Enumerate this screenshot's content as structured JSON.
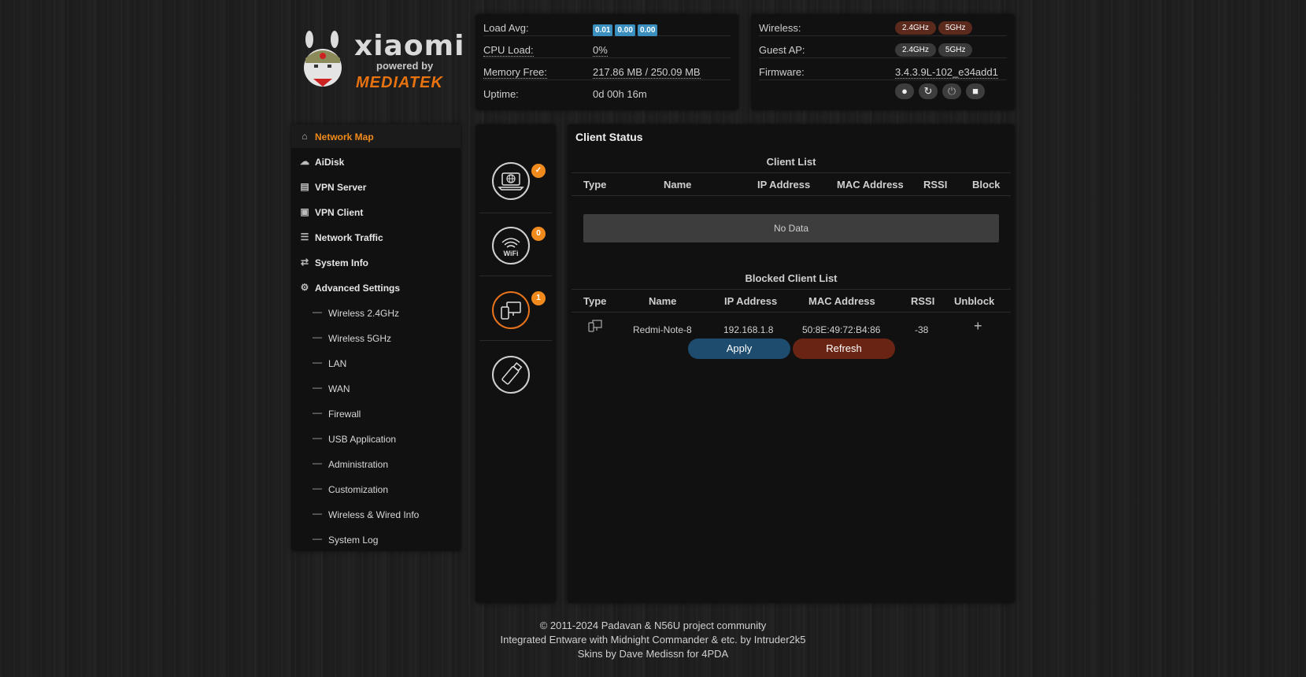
{
  "logo": {
    "brand": "xiaomi",
    "powered": "powered by",
    "vendor": "MEDIATEK"
  },
  "stats": {
    "load_label": "Load Avg:",
    "load_values": [
      "0.01",
      "0.00",
      "0.00"
    ],
    "cpu_label": "CPU Load:",
    "cpu_value": "0%",
    "mem_label": "Memory Free:",
    "mem_value": "217.86 MB / 250.09 MB",
    "uptime_label": "Uptime:",
    "uptime_value": "0d 00h 16m"
  },
  "wifi": {
    "wireless_label": "Wireless:",
    "guest_label": "Guest AP:",
    "firmware_label": "Firmware:",
    "band_24": "2.4GHz",
    "band_5": "5GHz",
    "firmware_value": "3.4.3.9L-102_e34add1",
    "wireless_24_state": "on",
    "wireless_5_state": "on",
    "guest_24_state": "off",
    "guest_5_state": "off"
  },
  "sidebar": {
    "items": [
      {
        "label": "Network Map",
        "icon": "home-icon"
      },
      {
        "label": "AiDisk",
        "icon": "cloud-icon"
      },
      {
        "label": "VPN Server",
        "icon": "vpn-server-icon"
      },
      {
        "label": "VPN Client",
        "icon": "vpn-client-icon"
      },
      {
        "label": "Network Traffic",
        "icon": "traffic-icon"
      },
      {
        "label": "System Info",
        "icon": "shuffle-icon"
      },
      {
        "label": "Advanced Settings",
        "icon": "gear-icon"
      }
    ],
    "subitems": [
      "Wireless 2.4GHz",
      "Wireless 5GHz",
      "LAN",
      "WAN",
      "Firewall",
      "USB Application",
      "Administration",
      "Customization",
      "Wireless & Wired Info",
      "System Log"
    ]
  },
  "iconcol": {
    "wifi_count": "0",
    "clients_count": "1"
  },
  "main": {
    "title": "Client Status",
    "client_list": {
      "title": "Client List",
      "headers": [
        "Type",
        "Name",
        "IP Address",
        "MAC Address",
        "RSSI",
        "Block"
      ],
      "empty": "No Data"
    },
    "blocked_list": {
      "title": "Blocked Client List",
      "headers": [
        "Type",
        "Name",
        "IP Address",
        "MAC Address",
        "RSSI",
        "Unblock"
      ],
      "rows": [
        {
          "name": "Redmi-Note-8",
          "ip": "192.168.1.8",
          "mac": "50:8E:49:72:B4:86",
          "rssi": "-38",
          "unblock": "+"
        }
      ]
    },
    "apply": "Apply",
    "refresh": "Refresh"
  },
  "footer": [
    "© 2011-2024 Padavan & N56U project community",
    "Integrated Entware with Midnight Commander & etc. by Intruder2k5",
    "Skins by Dave Medissn for 4PDA"
  ],
  "colors": {
    "accent": "#f08a1c",
    "band_on": "#5c2a1c",
    "badge": "#3a8fbf",
    "apply": "#1d4c6e",
    "refresh": "#6a2413"
  }
}
